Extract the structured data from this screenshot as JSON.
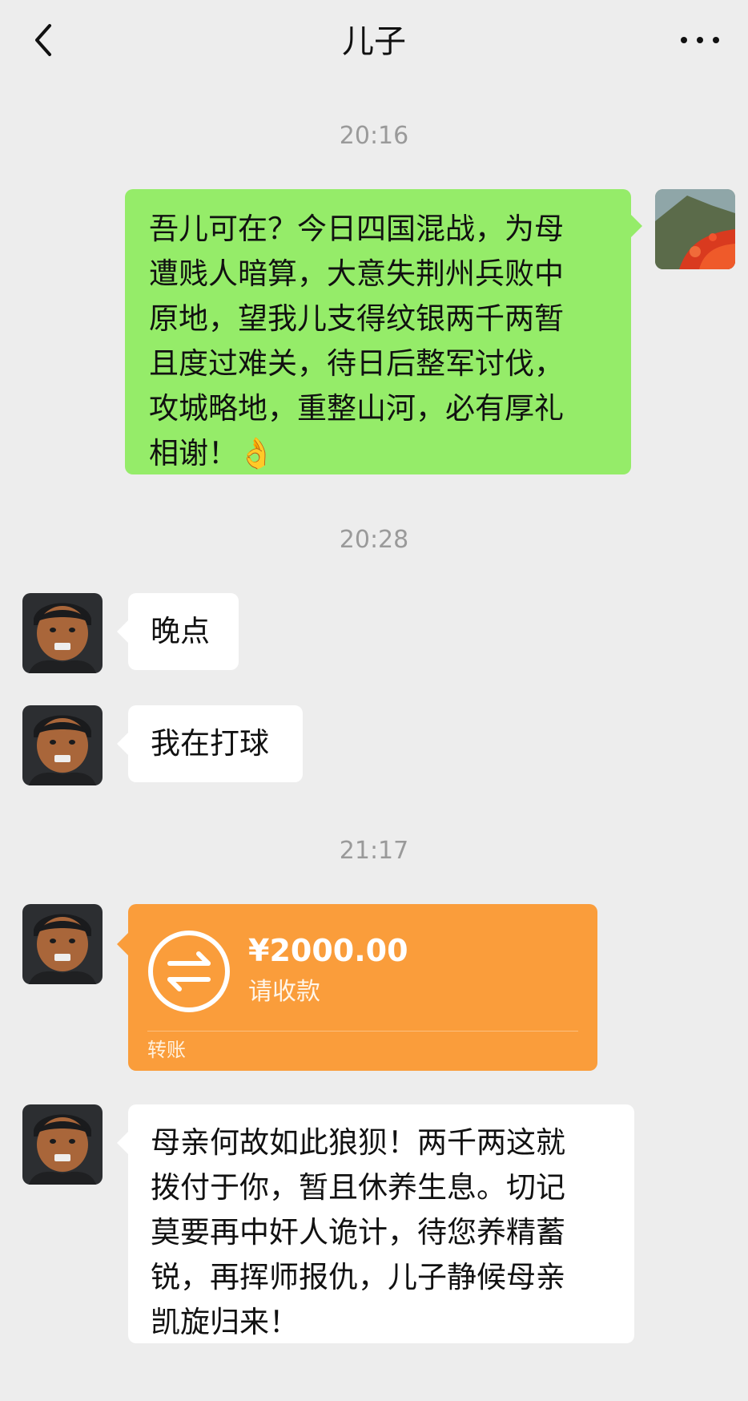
{
  "header": {
    "title": "儿子",
    "back_icon": "chevron-left-icon",
    "more_icon": "more-dots-icon"
  },
  "messages": {
    "t1": "20:16",
    "m1": "吾儿可在？今日四国混战，为母\n遭贱人暗算，大意失荆州兵败中\n原地，望我儿支得纹银两千两暂\n且度过难关，待日后整军讨伐，\n攻城略地，重整山河，必有厚礼\n相谢！👌",
    "t2": "20:28",
    "m2": "晚点",
    "m3": "我在打球",
    "t3": "21:17",
    "m5": "母亲何故如此狼狈！两千两这就\n拨付于你，暂且休养生息。切记\n莫要再中奸人诡计，待您养精蓄\n锐，再挥师报仇，儿子静候母亲\n凯旋归来！"
  },
  "transfer": {
    "amount": "¥2000.00",
    "status": "请收款",
    "label": "转账",
    "icon": "transfer-arrows-icon",
    "color": "#fa9d3b"
  },
  "colors": {
    "mine_bubble": "#95ec69",
    "their_bubble": "#ffffff",
    "background": "#ededed"
  }
}
